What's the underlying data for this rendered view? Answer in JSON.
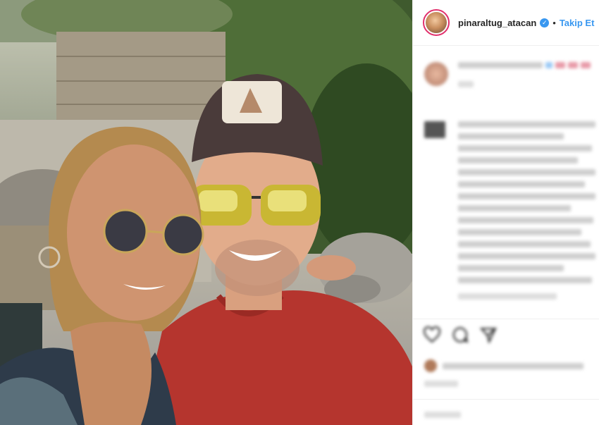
{
  "post": {
    "username": "pinaraltug_atacan",
    "verified_mark": "✓",
    "separator": "•",
    "follow_label": "Takip Et"
  },
  "icons": {
    "verified": "verified-badge-icon",
    "like": "heart-icon",
    "comment": "comment-icon",
    "share": "share-icon"
  },
  "colors": {
    "accent": "#3897f0",
    "story_ring": "#e1306c",
    "shirt": "#b5352e"
  }
}
